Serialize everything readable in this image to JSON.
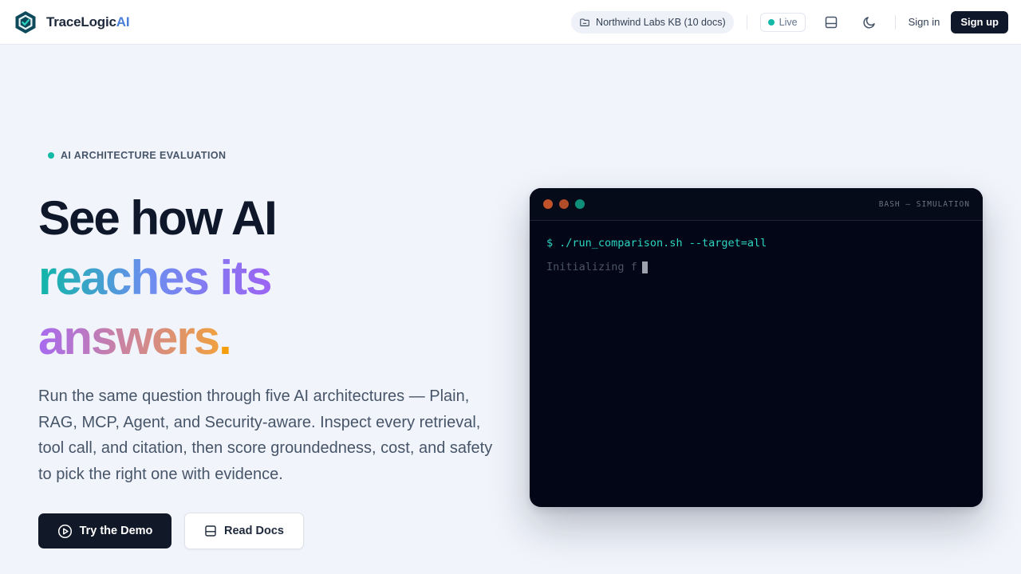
{
  "header": {
    "brand_name": "TraceLogic",
    "brand_suffix": "AI",
    "kb_chip": "Northwind Labs KB (10 docs)",
    "live_label": "Live",
    "signin_label": "Sign in",
    "signup_label": "Sign up"
  },
  "hero": {
    "eyebrow": "AI ARCHITECTURE EVALUATION",
    "headline_line1": "See how AI",
    "headline_line2": "reaches its",
    "headline_line3": "answers",
    "headline_period": ".",
    "lede": "Run the same question through five AI architectures — Plain, RAG, MCP, Agent, and Security-aware. Inspect every retrieval, tool call, and citation, then score groundedness, cost, and safety to pick the right one with evidence.",
    "primary_cta": "Try the Demo",
    "secondary_cta": "Read Docs"
  },
  "terminal": {
    "title": "BASH — SIMULATION",
    "prompt": "$",
    "command": "./run_comparison.sh --target=all",
    "output": "Initializing f"
  },
  "colors": {
    "accent_teal": "#14b8a6",
    "brand_blue": "#4a7fd8",
    "dark": "#0f172a"
  },
  "icons": {
    "logo": "hexagon-check-icon",
    "kb": "folder-icon",
    "layout": "panel-icon",
    "theme": "moon-icon",
    "play": "play-circle-icon",
    "docs": "book-icon"
  }
}
